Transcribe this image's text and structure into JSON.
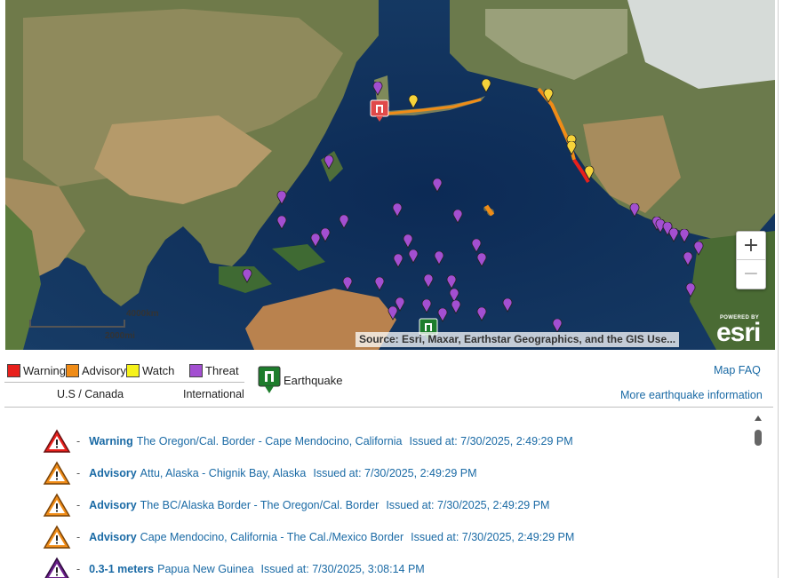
{
  "map": {
    "attribution": "Source: Esri, Maxar, Earthstar Geographics, and the GIS Use...",
    "scale_km": "4000km",
    "scale_mi": "2000mi",
    "powered_by": "POWERED BY",
    "esri": "esri",
    "zoom_in": "+",
    "zoom_out": "−",
    "colors": {
      "warning": "#e8201c",
      "advisory": "#f08c17",
      "watch": "#f6d33a",
      "threat": "#a34fd1",
      "earthquake": "#1d7d2c"
    }
  },
  "legend": {
    "warning": "Warning",
    "advisory": "Advisory",
    "watch": "Watch",
    "threat": "Threat",
    "us_canada": "U.S / Canada",
    "international": "International",
    "earthquake": "Earthquake",
    "map_faq": "Map FAQ",
    "more_eq": "More earthquake information"
  },
  "alerts": [
    {
      "kind": "Warning",
      "region": "The Oregon/Cal. Border - Cape Mendocino, California",
      "issued": "Issued at: 7/30/2025, 2:49:29 PM",
      "level": "warning"
    },
    {
      "kind": "Advisory",
      "region": "Attu, Alaska - Chignik Bay, Alaska",
      "issued": "Issued at: 7/30/2025, 2:49:29 PM",
      "level": "advisory"
    },
    {
      "kind": "Advisory",
      "region": "The BC/Alaska Border - The Oregon/Cal. Border",
      "issued": "Issued at: 7/30/2025, 2:49:29 PM",
      "level": "advisory"
    },
    {
      "kind": "Advisory",
      "region": "Cape Mendocino, California - The Cal./Mexico Border",
      "issued": "Issued at: 7/30/2025, 2:49:29 PM",
      "level": "advisory"
    },
    {
      "kind": "0.3-1 meters",
      "region": "Papua New Guinea",
      "issued": "Issued at: 7/30/2025, 3:08:14 PM",
      "level": "threat"
    }
  ]
}
